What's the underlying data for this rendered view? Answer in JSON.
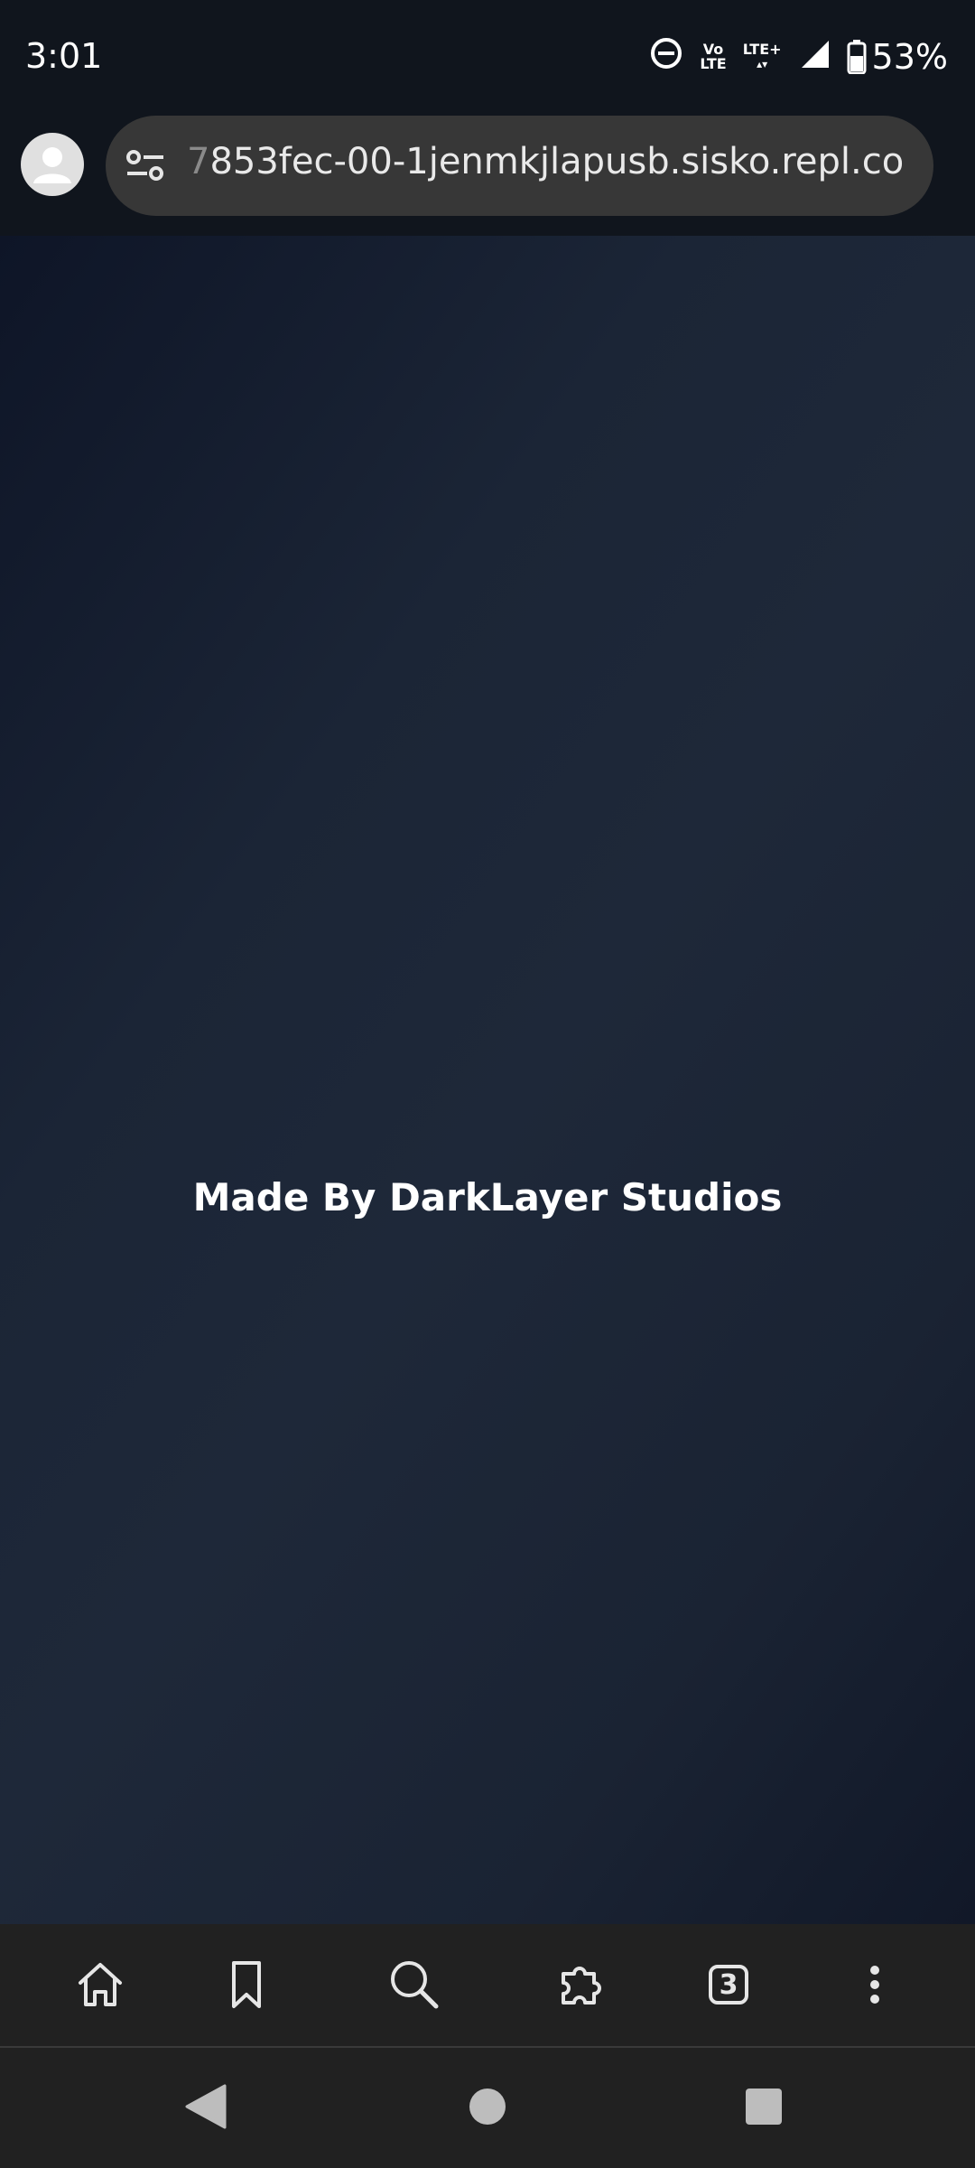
{
  "status_bar": {
    "time": "3:01",
    "volte_top": "Vo",
    "volte_bottom": "LTE",
    "network_label": "LTE+",
    "battery_percent": "53%",
    "icons": [
      "do-not-disturb-icon",
      "volte-icon",
      "lte-plus-icon",
      "signal-icon",
      "battery-icon"
    ]
  },
  "browser": {
    "url_fade_char": "7",
    "url_text": "853fec-00-1jenmkjlapusb.sisko.repl.co",
    "icons": [
      "account-avatar-icon",
      "site-settings-icon"
    ]
  },
  "page": {
    "credit_text": "Made By DarkLayer Studios",
    "text_color": "#ffffff",
    "background_colors": [
      "#0e1527",
      "#1e2839",
      "#111828"
    ]
  },
  "toolbar": {
    "tabs_count": "3",
    "icons": [
      "home-icon",
      "bookmark-icon",
      "search-icon",
      "extensions-icon",
      "tabs-icon",
      "more-menu-icon"
    ]
  },
  "nav_bar": {
    "icons": [
      "back-icon",
      "home-circle-icon",
      "recents-icon"
    ]
  }
}
